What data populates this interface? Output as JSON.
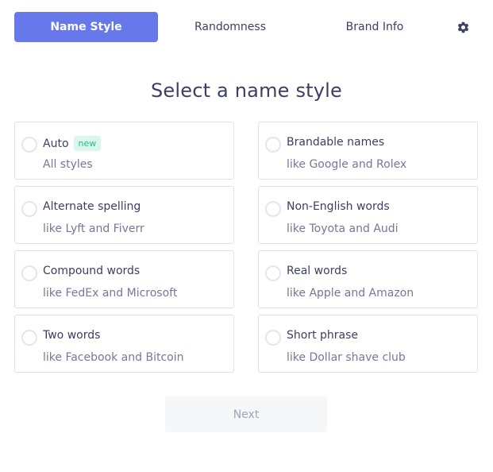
{
  "tabs": [
    {
      "label": "Name Style",
      "active": true
    },
    {
      "label": "Randomness",
      "active": false
    },
    {
      "label": "Brand Info",
      "active": false
    }
  ],
  "settings_icon": "gear-icon",
  "heading": "Select a name style",
  "options": [
    {
      "title": "Auto",
      "badge": "new",
      "subtitle": "All styles"
    },
    {
      "title": "Brandable names",
      "subtitle": "like Google and Rolex"
    },
    {
      "title": "Alternate spelling",
      "subtitle": "like Lyft and Fiverr"
    },
    {
      "title": "Non-English words",
      "subtitle": "like Toyota and Audi"
    },
    {
      "title": "Compound words",
      "subtitle": "like FedEx and Microsoft"
    },
    {
      "title": "Real words",
      "subtitle": "like Apple and Amazon"
    },
    {
      "title": "Two words",
      "subtitle": "like Facebook and Bitcoin"
    },
    {
      "title": "Short phrase",
      "subtitle": "like Dollar shave club"
    }
  ],
  "next_label": "Next",
  "colors": {
    "accent": "#6678ea",
    "text": "#3b3f63",
    "muted": "#72799a",
    "badge_bg": "#d9f7ee",
    "badge_text": "#2bb985",
    "border": "#dfe2ea"
  }
}
